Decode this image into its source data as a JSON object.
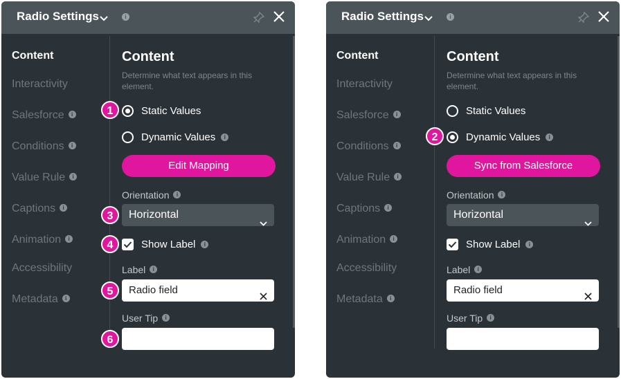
{
  "colors": {
    "panel_bg": "#2b3237",
    "header_bg": "#4b5459",
    "accent_pink": "#e0179e",
    "muted_text": "#6e777c"
  },
  "panels": [
    {
      "header": {
        "title": "Radio Settings",
        "icons": [
          "chevron-down-icon",
          "info-icon",
          "pin-icon",
          "close-icon"
        ]
      },
      "sidebar": [
        "Content",
        "Interactivity",
        "Salesforce",
        "Conditions",
        "Value Rule",
        "Captions",
        "Animation",
        "Accessibility",
        "Metadata"
      ],
      "content": {
        "heading": "Content",
        "description": "Determine what text appears in this element.",
        "static_values": "Static Values",
        "dynamic_values": "Dynamic Values",
        "selected": "static",
        "action_button": "Edit Mapping",
        "orientation_label": "Orientation",
        "orientation_value": "Horizontal",
        "show_label": "Show Label",
        "show_label_checked": true,
        "label_label": "Label",
        "label_value": "Radio field",
        "user_tip_label": "User Tip",
        "user_tip_value": ""
      },
      "badges": [
        "1",
        "3",
        "4",
        "5",
        "6"
      ]
    },
    {
      "header": {
        "title": "Radio Settings",
        "icons": [
          "chevron-down-icon",
          "info-icon",
          "pin-icon",
          "close-icon"
        ]
      },
      "sidebar": [
        "Content",
        "Interactivity",
        "Salesforce",
        "Conditions",
        "Value Rule",
        "Captions",
        "Animation",
        "Accessibility",
        "Metadata"
      ],
      "content": {
        "heading": "Content",
        "description": "Determine what text appears in this element.",
        "static_values": "Static Values",
        "dynamic_values": "Dynamic Values",
        "selected": "dynamic",
        "action_button": "Sync from Salesforce",
        "orientation_label": "Orientation",
        "orientation_value": "Horizontal",
        "show_label": "Show Label",
        "show_label_checked": true,
        "label_label": "Label",
        "label_value": "Radio field",
        "user_tip_label": "User Tip",
        "user_tip_value": ""
      },
      "badges": [
        "2"
      ]
    }
  ]
}
